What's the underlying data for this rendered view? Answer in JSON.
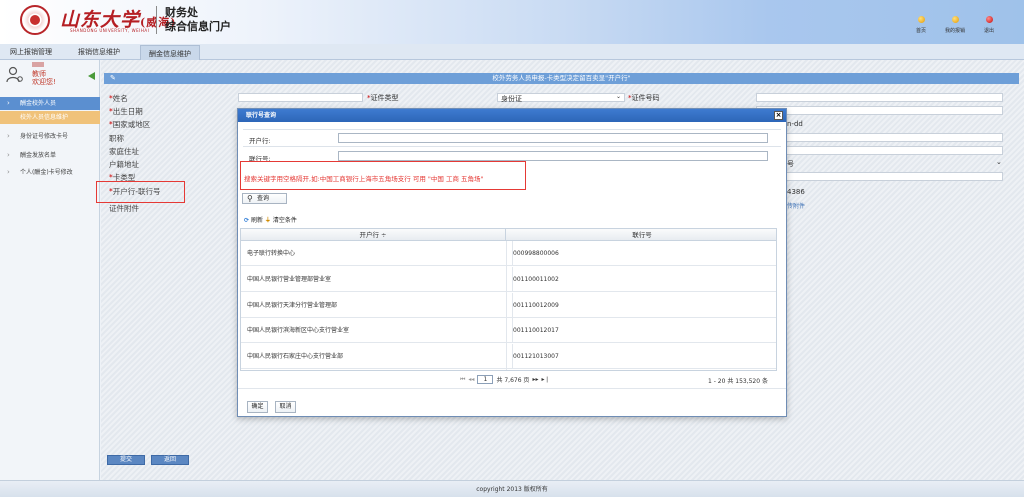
{
  "header": {
    "logo_cn": "山东大学",
    "logo_cn_suffix": "(威海)",
    "logo_en": "SHANDONG UNIVERSITY, WEIHAI",
    "title_line1": "财务处",
    "title_line2": "综合信息门户",
    "nav": [
      {
        "label": "首页",
        "color": "orange"
      },
      {
        "label": "我的报销",
        "color": "orange"
      },
      {
        "label": "退出",
        "color": "red"
      }
    ]
  },
  "tabs": [
    {
      "label": "网上报销管理",
      "active": false
    },
    {
      "label": "报销信息维护",
      "active": false
    },
    {
      "label": "酬金信息维护",
      "active": true
    }
  ],
  "sidebar": {
    "user_role": "教师",
    "welcome": "欢迎您!",
    "items": [
      {
        "label": "酬金校外人员",
        "state": "selected",
        "chev": "›"
      },
      {
        "label": "校外人员信息维护",
        "state": "sub",
        "chev": ""
      },
      {
        "label": "身份证号修改卡号",
        "state": "normal",
        "chev": "›"
      },
      {
        "label": "酬金发放名单",
        "state": "normal",
        "chev": "›"
      },
      {
        "label": "个人(酬金)卡号修改",
        "state": "normal",
        "chev": "›"
      }
    ]
  },
  "form": {
    "title": "校外劳务人员申报-卡类型决定留百卖显\"开户行\"",
    "rows": [
      {
        "label": "姓名",
        "required": true
      },
      {
        "label": "出生日期",
        "required": true
      },
      {
        "label": "国家或地区",
        "required": true
      },
      {
        "label": "职称",
        "required": false
      },
      {
        "label": "家庭住址",
        "required": false
      },
      {
        "label": "户籍地址",
        "required": false
      },
      {
        "label": "卡类型",
        "required": true
      },
      {
        "label": "开户行-联行号",
        "required": true
      },
      {
        "label": "证件附件",
        "required": false
      }
    ],
    "cert_type_label": "证件类型",
    "cert_type_value": "身份证",
    "cert_no_label": "证件号码",
    "date_placeholder_tail": "n-dd",
    "right_fragment_1": "号",
    "right_fragment_2": "4386",
    "right_fragment_3": "传附件",
    "submit_label": "提交",
    "back_label": "返回"
  },
  "dialog": {
    "title": "联行号查询",
    "close": "×",
    "field1_label": "开户行:",
    "field2_label": "联行号:",
    "hint": "搜索关键字用空格隔开,如:中国工商银行上海市五角场支行 可用 \"中国 工商 五角场\"",
    "search_label": "查询",
    "refresh_label": "刷新",
    "clear_label": "清空条件",
    "col1": "开户行 ÷",
    "col2": "联行号",
    "rows": [
      {
        "bank": "电子联行转换中心",
        "code": "000998800006"
      },
      {
        "bank": "中国人民银行营业管理部营业室",
        "code": "001100011002"
      },
      {
        "bank": "中国人民银行天津分行营业管理部",
        "code": "001110012009"
      },
      {
        "bank": "中国人民银行滨海新区中心支行营业室",
        "code": "001110012017"
      },
      {
        "bank": "中国人民银行石家庄中心支行营业部",
        "code": "001121013007"
      }
    ],
    "pager": {
      "first": "⏮",
      "prev": "◂◂",
      "page": "1",
      "total_pages": "共 7,676 页",
      "next": "▸▸",
      "last": "▸❘",
      "info": "1 - 20 共 153,520 条"
    },
    "ok_label": "确定",
    "cancel_label": "取消"
  },
  "footer": {
    "copyright": "copyright 2013 版权所有"
  }
}
